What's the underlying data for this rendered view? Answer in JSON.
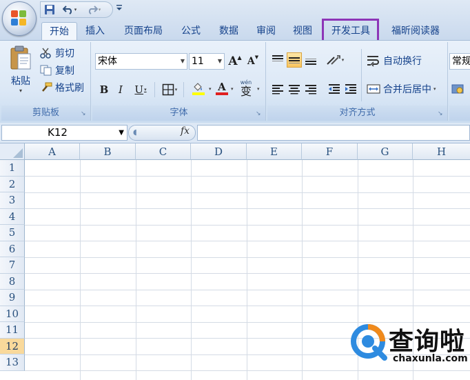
{
  "quick_access": {
    "save_icon": "save-icon",
    "undo_icon": "undo-icon",
    "redo_icon": "redo-icon",
    "more": "▾"
  },
  "tabs": [
    {
      "label": "开始",
      "active": true
    },
    {
      "label": "插入"
    },
    {
      "label": "页面布局"
    },
    {
      "label": "公式"
    },
    {
      "label": "数据"
    },
    {
      "label": "审阅"
    },
    {
      "label": "视图"
    },
    {
      "label": "开发工具",
      "highlighted": true
    },
    {
      "label": "福昕阅读器"
    }
  ],
  "ribbon": {
    "clipboard": {
      "paste_label": "粘贴",
      "cut_label": "剪切",
      "copy_label": "复制",
      "format_painter_label": "格式刷",
      "group_label": "剪贴板"
    },
    "font": {
      "font_name": "宋体",
      "font_size": "11",
      "grow": "A",
      "shrink": "A",
      "bold": "B",
      "italic": "I",
      "underline": "U",
      "font_color_letter": "A",
      "phonetic": "wén",
      "phonetic_char": "变",
      "group_label": "字体"
    },
    "alignment": {
      "wrap_text_label": "自动换行",
      "merge_center_label": "合并后居中",
      "group_label": "对齐方式"
    },
    "number": {
      "format_label": "常规"
    }
  },
  "formula_bar": {
    "name_box": "K12",
    "fx": "fx",
    "formula": ""
  },
  "grid": {
    "columns": [
      "A",
      "B",
      "C",
      "D",
      "E",
      "F",
      "G",
      "H"
    ],
    "rows": [
      "1",
      "2",
      "3",
      "4",
      "5",
      "6",
      "7",
      "8",
      "9",
      "10",
      "11",
      "12",
      "13"
    ],
    "active_row": "12"
  },
  "watermark": {
    "title": "查询啦",
    "url": "chaxunla.com"
  },
  "colors": {
    "highlight_border": "#8d35b7",
    "active_row_header": "#f9d99b",
    "font_color_bar": "#e02020",
    "fill_color_bar": "#ffff00"
  }
}
